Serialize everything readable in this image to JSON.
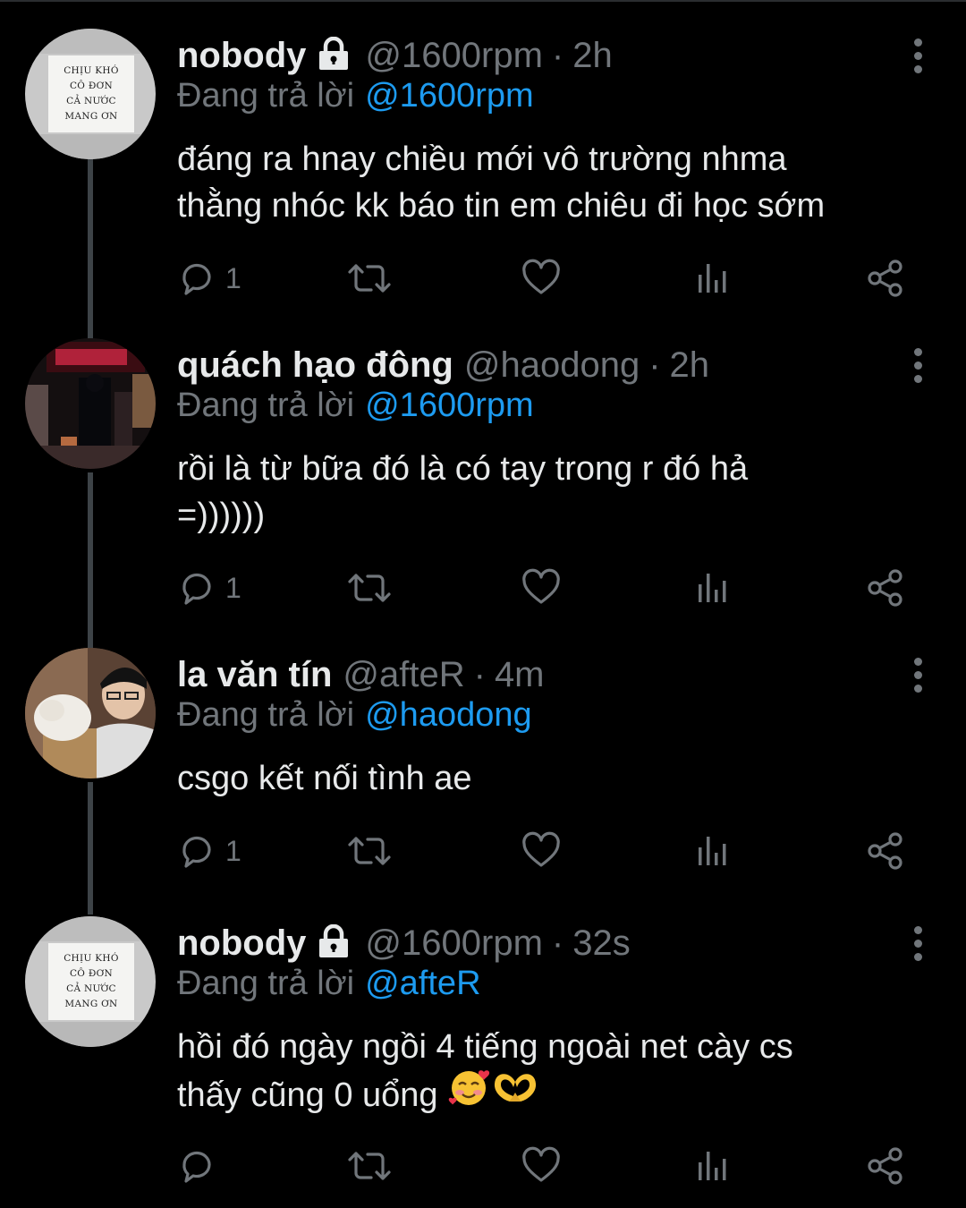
{
  "tweets": [
    {
      "display_name": "nobody",
      "protected": true,
      "handle": "@1600rpm",
      "time": "2h",
      "reply_prefix": "Đang trả lời",
      "reply_to": "@1600rpm",
      "lines": [
        "đáng ra hnay chiều mới vô trường nhma",
        "thằng nhóc kk báo tin em chiêu đi học sớm"
      ],
      "reply_count": "1",
      "avatar": {
        "type": "sign",
        "sign_lines": [
          "CHỊU KHÓ",
          "CÔ ĐƠN",
          "CẢ NƯỚC",
          "MANG ƠN"
        ]
      }
    },
    {
      "display_name": "quách hạo đông",
      "protected": false,
      "handle": "@haodong",
      "time": "2h",
      "reply_prefix": "Đang trả lời",
      "reply_to": "@1600rpm",
      "lines": [
        "rồi là từ bữa đó là có tay trong r đó hả",
        "=))))))"
      ],
      "reply_count": "1",
      "avatar": {
        "type": "photo-street",
        "sign_lines": []
      }
    },
    {
      "display_name": "la văn tín",
      "protected": false,
      "handle": "@afteR",
      "time": "4m",
      "reply_prefix": "Đang trả lời",
      "reply_to": "@haodong",
      "lines": [
        "csgo kết nối tình ae"
      ],
      "reply_count": "1",
      "avatar": {
        "type": "photo-dog",
        "sign_lines": []
      }
    },
    {
      "display_name": "nobody",
      "protected": true,
      "handle": "@1600rpm",
      "time": "32s",
      "reply_prefix": "Đang trả lời",
      "reply_to": "@afteR",
      "lines": [
        "hồi đó ngày ngồi 4 tiếng ngoài net cày cs",
        "thấy cũng 0 uổng"
      ],
      "reply_count": "",
      "avatar": {
        "type": "sign",
        "sign_lines": [
          "CHỊU KHÓ",
          "CÔ ĐƠN",
          "CẢ NƯỚC",
          "MANG ƠN"
        ]
      },
      "emojis": [
        "smiling-face-with-hearts",
        "heart-hands"
      ]
    }
  ],
  "icons": [
    "lock-icon",
    "more-icon",
    "reply-icon",
    "retweet-icon",
    "like-icon",
    "analytics-icon",
    "share-icon"
  ],
  "colors": {
    "background": "#000000",
    "text": "#e7e9ea",
    "muted": "#71767b",
    "link": "#1d9bf0",
    "thread_line": "#3d4347"
  }
}
